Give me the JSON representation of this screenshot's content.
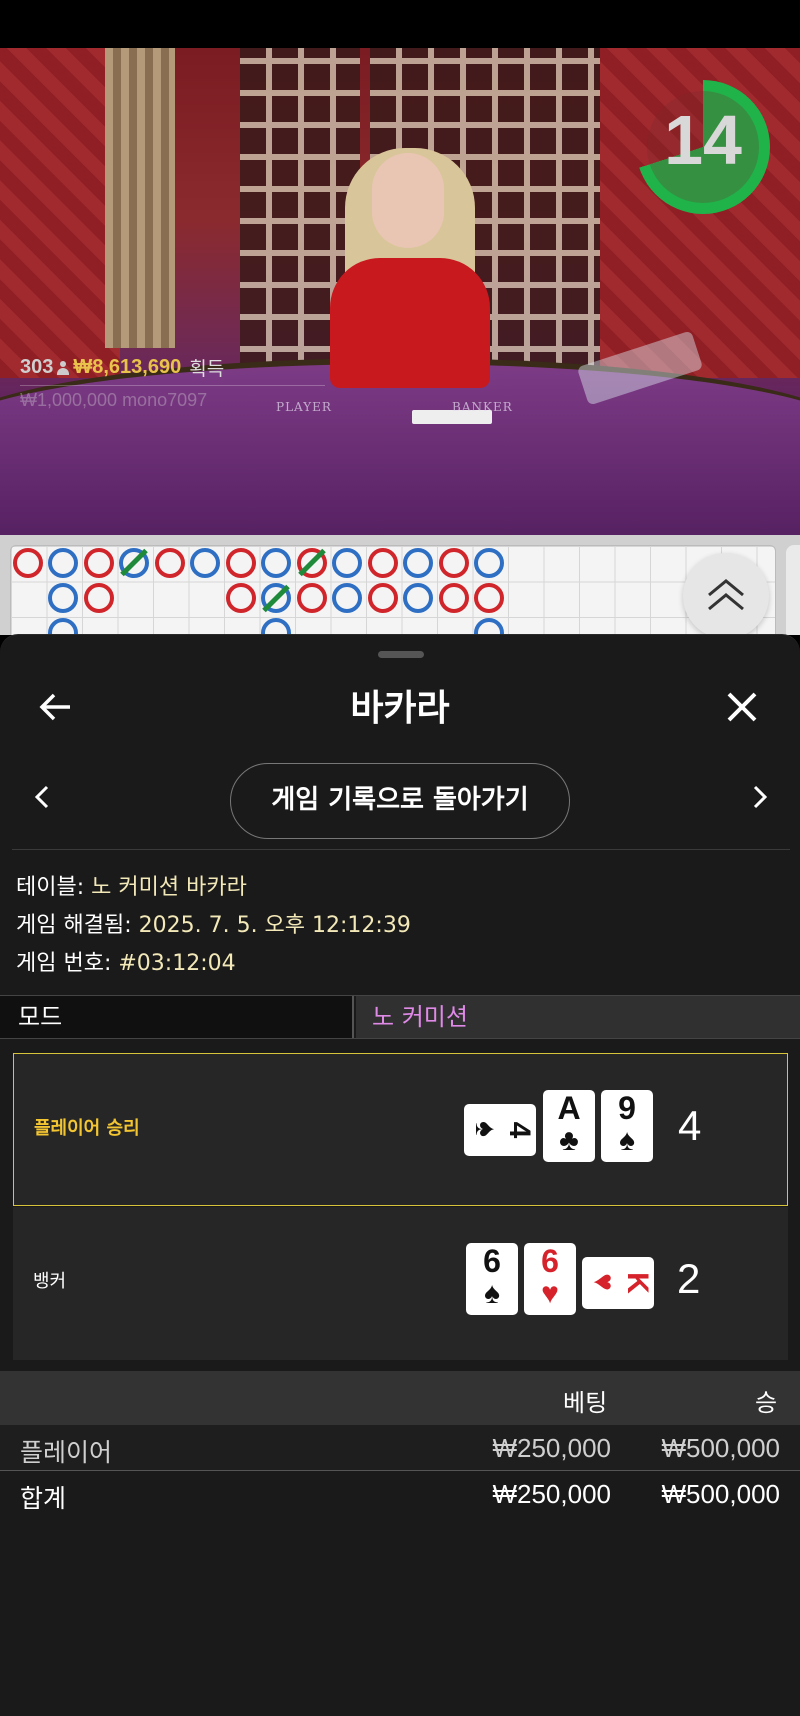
{
  "video": {
    "timer": "14",
    "winners_count": "303",
    "winners_amount": "₩8,613,690",
    "winners_label": "획득",
    "felt_left": "PLAYER",
    "felt_right": "BANKER",
    "faded_line": "₩1,000,000   mono7097"
  },
  "roadmap": {
    "colors": {
      "banker": "#d0262b",
      "player": "#2e6fc4",
      "tie": "#1f8a3a"
    }
  },
  "sheet": {
    "title": "바카라",
    "back_to_history": "게임 기록으로 돌아가기",
    "info": [
      {
        "label": "테이블: ",
        "value": "노 커미션 바카라"
      },
      {
        "label": "게임 해결됨: ",
        "value": "2025. 7. 5. 오후 12:12:39"
      },
      {
        "label": "게임 번호: ",
        "value": "#03:12:04"
      }
    ],
    "mode": {
      "label": "모드",
      "value": "노 커미션"
    },
    "hands": {
      "player": {
        "label": "플레이어 승리",
        "score": "4",
        "cards": [
          {
            "rank": "4",
            "suit": "♠"
          },
          {
            "rank": "A",
            "suit": "♣"
          },
          {
            "rank": "9",
            "suit": "♠"
          }
        ]
      },
      "banker": {
        "label": "뱅커",
        "score": "2",
        "cards": [
          {
            "rank": "6",
            "suit": "♠"
          },
          {
            "rank": "6",
            "suit": "♥"
          },
          {
            "rank": "K",
            "suit": "♥"
          }
        ]
      }
    },
    "bets": {
      "headers": {
        "bet": "베팅",
        "win": "승"
      },
      "rows": [
        {
          "name": "플레이어",
          "bet": "₩250,000",
          "win": "₩500,000"
        }
      ],
      "total": {
        "name": "합계",
        "bet": "₩250,000",
        "win": "₩500,000"
      }
    }
  }
}
